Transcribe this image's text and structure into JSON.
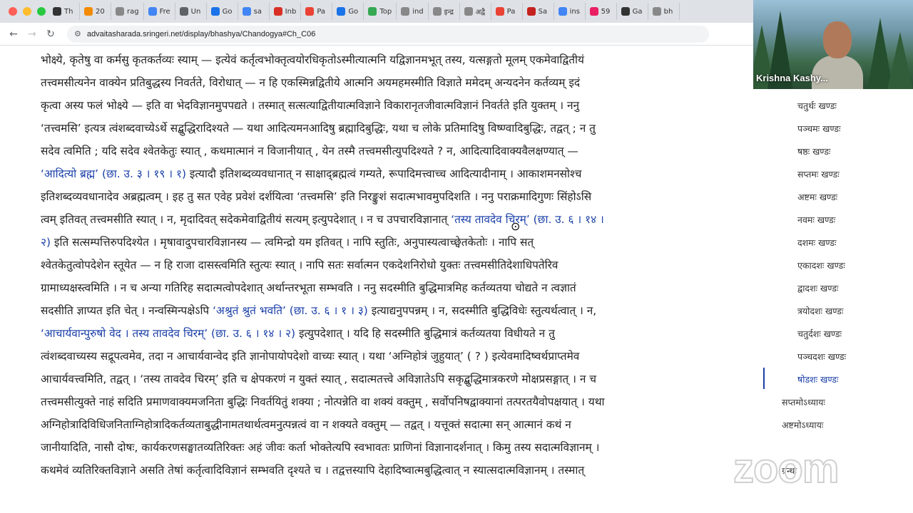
{
  "browser": {
    "tabs": [
      {
        "label": "Th",
        "color": "#333333"
      },
      {
        "label": "20",
        "color": "#f28b00"
      },
      {
        "label": "rag",
        "color": "#888888"
      },
      {
        "label": "Fre",
        "color": "#4285f4"
      },
      {
        "label": "Un",
        "color": "#5f6368"
      },
      {
        "label": "Go",
        "color": "#1a73e8"
      },
      {
        "label": "sa",
        "color": "#4285f4"
      },
      {
        "label": "Inb",
        "color": "#d93025"
      },
      {
        "label": "Pa",
        "color": "#ea4335"
      },
      {
        "label": "Go",
        "color": "#1a73e8"
      },
      {
        "label": "Top",
        "color": "#34a853"
      },
      {
        "label": "ind",
        "color": "#888888"
      },
      {
        "label": "इन्द्र",
        "color": "#888888"
      },
      {
        "label": "अद्वै",
        "color": "#888888"
      },
      {
        "label": "Pa",
        "color": "#ea4335"
      },
      {
        "label": "Sa",
        "color": "#c5221f"
      },
      {
        "label": "ins",
        "color": "#4285f4"
      },
      {
        "label": "59",
        "color": "#e91e63"
      },
      {
        "label": "Ga",
        "color": "#333333"
      },
      {
        "label": "bh",
        "color": "#888888"
      }
    ],
    "url": "advaitasharada.sringeri.net/display/bhashya/Chandogya#Ch_C06",
    "colors": {
      "close": "#ff5f57",
      "minimize": "#febc2e",
      "maximize": "#28c840"
    }
  },
  "content": {
    "lines": [
      [
        {
          "t": "भोक्ष्ये, कृतेषु वा कर्मसु कृतकर्तव्यः स्याम् — इत्येवं कर्तृत्वभोक्तृत्वयोरधिकृतोऽस्मीत्यात्मनि यद्विज्ञानमभूत् तस्य, यत्सङ्गतो मूलम् एकमेवाद्वितीयं"
        }
      ],
      [
        {
          "t": "तत्त्वमसीत्यनेन वाक्येन प्रतिबुद्धस्य निवर्तते, विरोधात् — न हि एकस्मिन्नद्वितीये आत्मनि अयमहमस्मीति विज्ञाते ममेदम् अन्यदनेन कर्तव्यम् इदं"
        }
      ],
      [
        {
          "t": "कृत्वा अस्य फलं भोक्ष्ये — इति वा भेदविज्ञानमुपपद्यते । तस्मात् सत्सत्याद्वितीयात्मविज्ञाने विकारानृतजीवात्मविज्ञानं निवर्तते इति युक्तम् । ननु"
        }
      ],
      [
        {
          "t": "‘तत्त्वमसि’ इत्यत्र त्वंशब्दवाच्येऽर्थे सद्बुद्धिरादिश्यते — यथा आदित्यमनआदिषु ब्रह्मादिबुद्धिः, यथा च लोके प्रतिमादिषु विष्ण्वादिबुद्धिः, तद्वत् ; न तु"
        }
      ],
      [
        {
          "t": "सदेव त्वमिति ; यदि सदेव श्वेतकेतुः स्यात् , कथमात्मानं न विजानीयात् , येन तस्मै तत्त्वमसीत्युपदिश्यते ? न, आदित्यादिवाक्यवैलक्षण्यात् —"
        }
      ],
      [
        {
          "t": "‘आदित्यो ब्रह्म’ (छा. उ. ३ । १९ । १)",
          "hl": true
        },
        {
          "t": " इत्यादौ इतिशब्दव्यवधानात् न साक्षाद्ब्रह्मत्वं गम्यते, रूपादिमत्त्वाच्च आदित्यादीनाम् । आकाशमनसोश्च"
        }
      ],
      [
        {
          "t": "इतिशब्दव्यवधानादेव अब्रह्मत्वम् । इह तु सत एवेह प्रवेशं दर्शयित्वा ‘तत्त्वमसि’ इति निरङ्कुशं सदात्मभावमुपदिशति । ननु पराक्रमादिगुणः सिंहोऽसि"
        }
      ],
      [
        {
          "t": "त्वम् इतिवत् तत्त्वमसीति स्यात् । न, मृदादिवत् सदेकमेवाद्वितीयं सत्यम् इत्युपदेशात् । न च उपचारविज्ञानात् "
        },
        {
          "t": "‘तस्य तावदेव चिरम्’ (छा. उ. ६ । १४ ।",
          "hl": true
        }
      ],
      [
        {
          "t": "२)",
          "hl": true
        },
        {
          "t": " इति सत्सम्पत्तिरुपदिश्येत । मृषावादुपचारविज्ञानस्य — त्वमिन्द्रो यम इतिवत् । नापि स्तुतिः, अनुपास्यत्वाच्छ्वेतकेतोः । नापि सत्"
        }
      ],
      [
        {
          "t": "श्वेतकेतुत्वोपदेशेन स्तूयेत — न हि राजा दासस्त्वमिति स्तुत्यः स्यात् । नापि सतः सर्वात्मन एकदेशनिरोधो युक्तः तत्त्वमसीतिदेशाधिपतेरिव"
        }
      ],
      [
        {
          "t": "ग्रामाध्यक्षस्त्वमिति । न च अन्या गतिरिह सदात्मत्वोपदेशात् अर्थान्तरभूता सम्भवति । ननु सदस्मीति बुद्धिमात्रमिह कर्तव्यतया चोद्यते न त्वज्ञातं"
        }
      ],
      [
        {
          "t": "सदसीति ज्ञाप्यत इति चेत् । नन्वस्मिन्पक्षेऽपि "
        },
        {
          "t": "‘अश्रुतं श्रुतं भवति’ (छा. उ. ६ । १ । ३)",
          "hl": true
        },
        {
          "t": " इत्याद्यनुपपन्नम् । न, सदस्मीति बुद्धिविधेः स्तुत्यर्थत्वात् । न,"
        }
      ],
      [
        {
          "t": "‘आचार्यवान्पुरुषो वेद । तस्य तावदेव चिरम्’ (छा. उ. ६ । १४ । २)",
          "hl": true
        },
        {
          "t": " इत्युपदेशात् । यदि हि सदस्मीति बुद्धिमात्रं कर्तव्यतया विधीयते न तु"
        }
      ],
      [
        {
          "t": "त्वंशब्दवाच्यस्य सद्रूपत्वमेव, तदा न आचार्यवान्वेद इति ज्ञानोपायोपदेशो वाच्यः स्यात् । यथा ‘अग्निहोत्रं जुहुयात्’ ( ? ) इत्येवमादिष्वर्थप्राप्तमेव"
        }
      ],
      [
        {
          "t": "आचार्यवत्त्वमिति, तद्वत् । ‘तस्य तावदेव चिरम्’ इति च क्षेपकरणं न युक्तं स्यात् , सदात्मतत्त्वे अविज्ञातेऽपि सकृद्बुद्धिमात्रकरणे मोक्षप्रसङ्गात् । न च"
        }
      ],
      [
        {
          "t": "तत्त्वमसीत्युक्ते नाहं सदिति प्रमाणवाक्यमजनिता बुद्धिः निवर्तयितुं शक्या ; नोत्पन्नेति वा शक्यं वक्तुम् , सर्वोपनिषद्वाक्यानां तत्परतयैवोपक्षयात् । यथा"
        }
      ],
      [
        {
          "t": "अग्निहोत्रादिविधिजनिताग्निहोत्रादिकर्तव्यताबुद्धीनामतथार्थत्वमनुत्पन्नत्वं वा न शक्यते वक्तुम् — तद्वत् । यत्तूक्तं सदात्मा सन् आत्मानं कथं न"
        }
      ],
      [
        {
          "t": "जानीयादिति, नासौ दोषः, कार्यकरणसङ्घातव्यतिरिक्तः अहं जीवः कर्ता भोक्तेत्यपि स्वभावतः प्राणिनां विज्ञानादर्शनात् । किमु तस्य सदात्मविज्ञानम् ।"
        }
      ],
      [
        {
          "t": "कथमेवं व्यतिरिक्तविज्ञाने असति तेषां कर्तृत्वादिविज्ञानं सम्भवति दृश्यते च । तद्वत्तस्यापि देहादिष्वात्मबुद्धित्वात् न स्यात्सदात्मविज्ञानम् । तस्मात्"
        }
      ]
    ]
  },
  "sidebar": {
    "items": [
      {
        "label": "चतुर्थः खण्डः"
      },
      {
        "label": "पञ्चमः खण्डः"
      },
      {
        "label": "षष्ठः खण्डः"
      },
      {
        "label": "सप्तमः खण्डः"
      },
      {
        "label": "अष्टमः खण्डः"
      },
      {
        "label": "नवमः खण्डः"
      },
      {
        "label": "दशमः खण्डः"
      },
      {
        "label": "एकादशः खण्डः"
      },
      {
        "label": "द्वादशः खण्डः"
      },
      {
        "label": "त्रयोदशः खण्डः"
      },
      {
        "label": "चतुर्दशः खण्डः"
      },
      {
        "label": "पञ्चदशः खण्डः"
      },
      {
        "label": "षोडशः खण्डः",
        "active": true
      }
    ],
    "chapters": [
      {
        "label": "सप्तमोऽध्यायः"
      },
      {
        "label": "अष्टमोऽध्यायः"
      }
    ],
    "footer_label": "ग्रन्थः"
  },
  "video": {
    "participant_name": "Krishna Kashy..."
  },
  "watermark": "zoom"
}
